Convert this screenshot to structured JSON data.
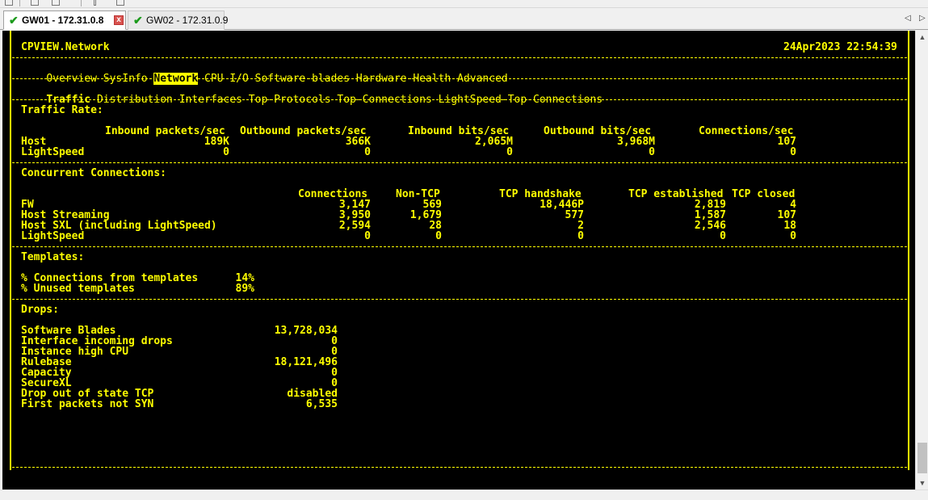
{
  "tabs": [
    {
      "label": "GW01 - 172.31.0.8",
      "close": "x"
    },
    {
      "label": "GW02 - 172.31.0.9"
    }
  ],
  "header": {
    "title": "CPVIEW.Network",
    "datetime": "24Apr2023 22:54:39"
  },
  "menu1": {
    "items": [
      "Overview",
      "SysInfo",
      "Network",
      "CPU",
      "I/O",
      "Software-blades",
      "Hardware-Health",
      "Advanced"
    ],
    "selected": "Network"
  },
  "menu2": {
    "items": [
      "Traffic",
      "Distribution",
      "Interfaces",
      "Top-Protocols",
      "Top-Connections",
      "LightSpeed-Top-Connections"
    ],
    "selected": "Traffic"
  },
  "traffic_rate": {
    "title": "Traffic Rate:",
    "columns": [
      "Inbound packets/sec",
      "Outbound packets/sec",
      "Inbound bits/sec",
      "Outbound bits/sec",
      "Connections/sec"
    ],
    "rows": [
      {
        "label": "Host",
        "values": [
          "189K",
          "366K",
          "2,065M",
          "3,968M",
          "107"
        ]
      },
      {
        "label": "LightSpeed",
        "values": [
          "0",
          "0",
          "0",
          "0",
          "0"
        ]
      }
    ]
  },
  "concurrent": {
    "title": "Concurrent Connections:",
    "columns": [
      "Connections",
      "Non-TCP",
      "TCP handshake",
      "TCP established",
      "TCP closed"
    ],
    "rows": [
      {
        "label": "FW",
        "values": [
          "3,147",
          "569",
          "18,446P",
          "2,819",
          "4"
        ]
      },
      {
        "label": "Host Streaming",
        "values": [
          "3,950",
          "1,679",
          "577",
          "1,587",
          "107"
        ]
      },
      {
        "label": "Host SXL (including LightSpeed)",
        "values": [
          "2,594",
          "28",
          "2",
          "2,546",
          "18"
        ]
      },
      {
        "label": "LightSpeed",
        "values": [
          "0",
          "0",
          "0",
          "0",
          "0"
        ]
      }
    ]
  },
  "templates": {
    "title": "Templates:",
    "rows": [
      {
        "label": "% Connections from templates",
        "value": "14%"
      },
      {
        "label": "% Unused templates",
        "value": "89%"
      }
    ]
  },
  "drops": {
    "title": "Drops:",
    "rows": [
      {
        "label": "Software Blades",
        "value": "13,728,034"
      },
      {
        "label": "Interface incoming drops",
        "value": "0"
      },
      {
        "label": "Instance high CPU",
        "value": "0"
      },
      {
        "label": "Rulebase",
        "value": "18,121,496"
      },
      {
        "label": "Capacity",
        "value": "0"
      },
      {
        "label": "SecureXL",
        "value": "0"
      },
      {
        "label": "Drop out of state TCP",
        "value": "disabled"
      },
      {
        "label": "First packets not SYN",
        "value": "6,535"
      }
    ]
  },
  "colors": {
    "terminal_bg": "#000000",
    "terminal_fg": "#ffff00"
  }
}
